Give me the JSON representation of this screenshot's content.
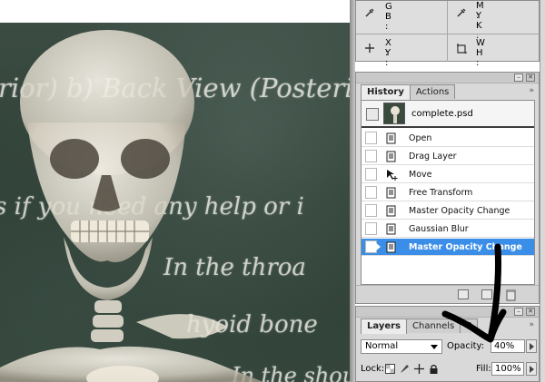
{
  "info": {
    "top_left": {
      "labels": [
        "G :",
        "B :"
      ]
    },
    "top_right": {
      "labels": [
        "M :",
        "Y :",
        "K :"
      ]
    },
    "bottom_left": {
      "labels": [
        "X :",
        "Y :"
      ]
    },
    "bottom_right": {
      "labels": [
        "W :",
        "H :"
      ]
    }
  },
  "history": {
    "tabs": [
      {
        "label": "History",
        "active": true
      },
      {
        "label": "Actions",
        "active": false
      }
    ],
    "menu_glyph": "»",
    "snapshot_name": "complete.psd",
    "steps": [
      {
        "label": "Open",
        "icon": "document-step-icon"
      },
      {
        "label": "Drag Layer",
        "icon": "document-step-icon"
      },
      {
        "label": "Move",
        "icon": "move-tool-icon"
      },
      {
        "label": "Free Transform",
        "icon": "document-step-icon"
      },
      {
        "label": "Master Opacity Change",
        "icon": "document-step-icon"
      },
      {
        "label": "Gaussian Blur",
        "icon": "document-step-icon"
      },
      {
        "label": "Master Opacity Change",
        "icon": "document-step-icon",
        "selected": true
      }
    ]
  },
  "layers": {
    "tabs": [
      {
        "label": "Layers",
        "active": true
      },
      {
        "label": "Channels",
        "active": false
      },
      {
        "label": "P",
        "active": false
      }
    ],
    "menu_glyph": "»",
    "blend_mode": "Normal",
    "opacity_label": "Opacity:",
    "opacity_value": "40%",
    "lock_label": "Lock:",
    "fill_label": "Fill:",
    "fill_value": "100%"
  },
  "canvas": {
    "chalk_lines": [
      "rior) b) Back View (Posteri",
      "s if you need any help or i",
      "In the throa",
      "hyoid bone",
      "In the should"
    ]
  },
  "colors": {
    "selection": "#3b8ee8",
    "panel_bg": "#d9d9d9",
    "chalkboard": "#2e3f35",
    "close_button": "#c2411e"
  }
}
